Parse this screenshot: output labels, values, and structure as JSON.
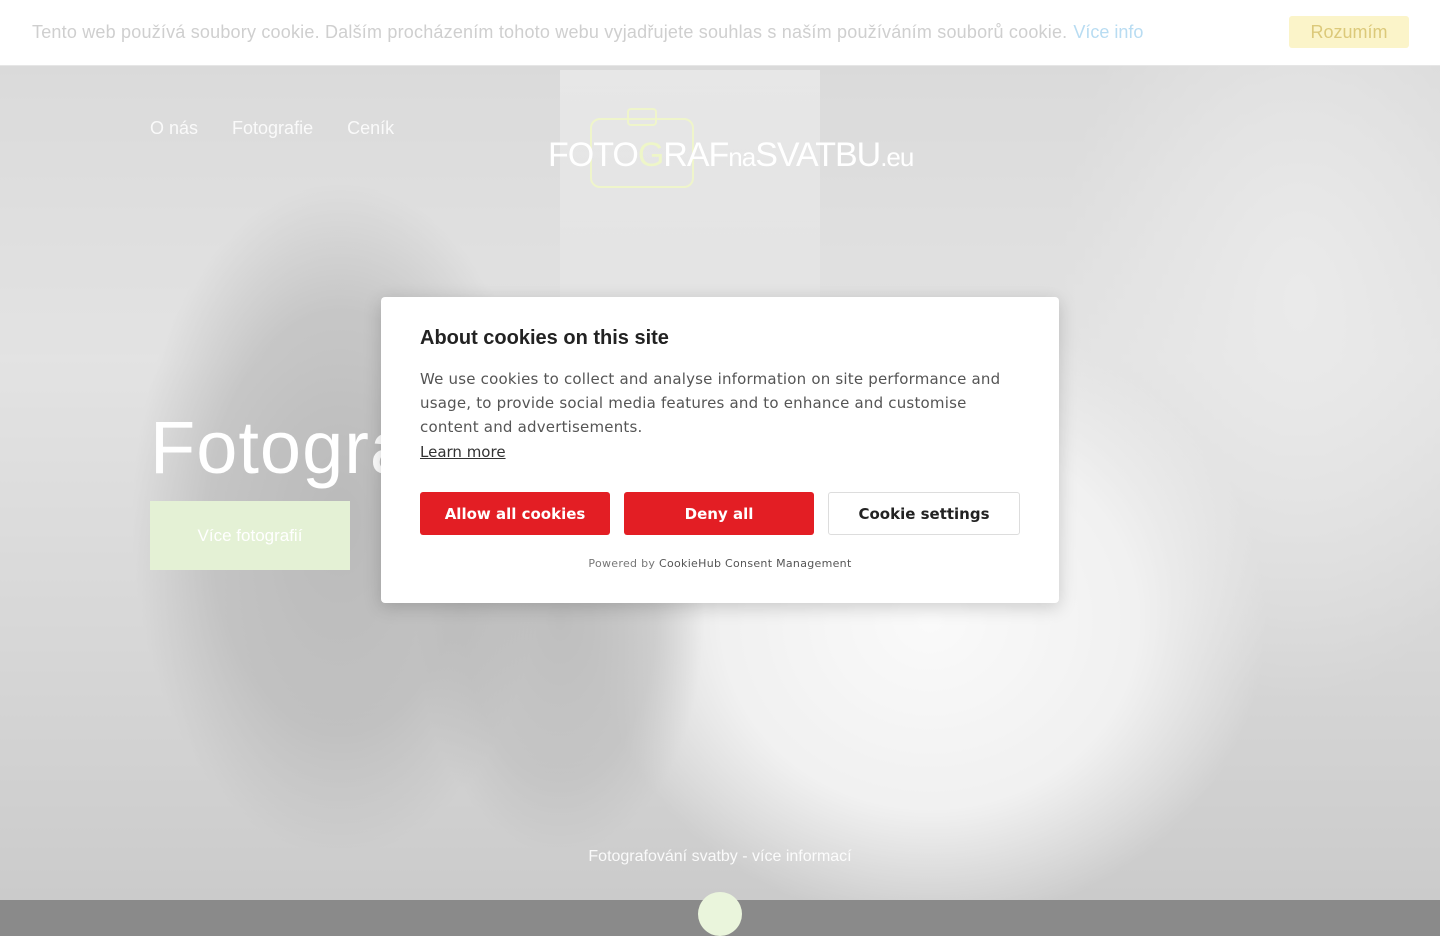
{
  "cookie_notice": {
    "text": "Tento web používá soubory cookie. Dalším procházením tohoto webu vyjadřujete souhlas s naším používáním souborů cookie.",
    "link": "Více info",
    "button": "Rozumím"
  },
  "nav": {
    "items": [
      "O nás",
      "Fotografie",
      "Ceník"
    ]
  },
  "logo": {
    "part1": "FOTO",
    "part2": "G",
    "part3": "RAF",
    "part4": "na",
    "part5": "SVATBU",
    "part6": ".eu"
  },
  "hero": {
    "title": "Fotogra",
    "button": "Více fotografií",
    "bottom_link": "Fotografování svatby - více informací"
  },
  "consent": {
    "title": "About cookies on this site",
    "body": "We use cookies to collect and analyse information on site performance and usage, to provide social media features and to enhance and customise content and advertisements.",
    "learn_more": "Learn more",
    "allow": "Allow all cookies",
    "deny": "Deny all",
    "settings": "Cookie settings",
    "powered_prefix": "Powered by",
    "powered_link": "CookieHub Consent Management"
  },
  "colors": {
    "consent_button": "#e31e24",
    "notice_button_bg": "#fbf4c9",
    "hero_button_bg": "#e4f1d5"
  }
}
